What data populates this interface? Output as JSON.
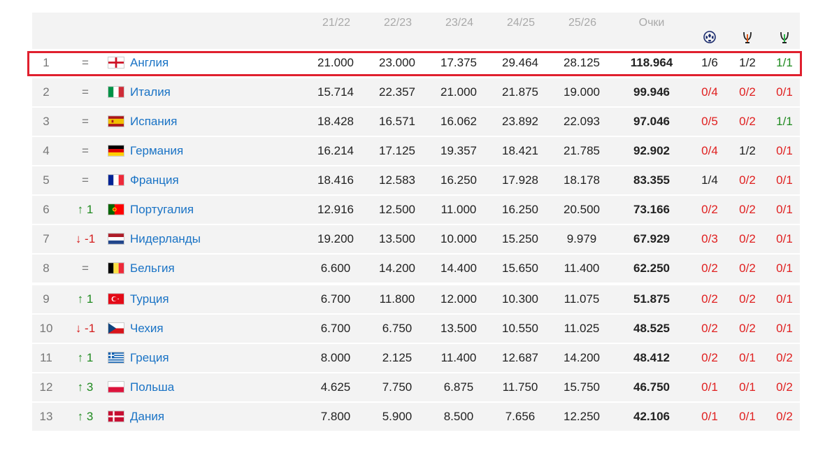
{
  "header": {
    "seasons": [
      "21/22",
      "22/23",
      "23/24",
      "24/25",
      "25/26"
    ],
    "points_label": "Очки",
    "competition_icons": [
      "champions-league-icon",
      "europa-league-icon",
      "conference-league-icon"
    ]
  },
  "colors": {
    "highlight_border": "#e0202e",
    "row_bg": "#f3f3f3",
    "country_link": "#1a73c5",
    "up": "#1f8a1f",
    "down": "#d41c1c",
    "eliminated": "#e02020"
  },
  "rows": [
    {
      "rank": "1",
      "move": "=",
      "move_dir": "same",
      "flag": "england",
      "country": "Англия",
      "scores": [
        "21.000",
        "23.000",
        "17.375",
        "29.464",
        "28.125"
      ],
      "total": "118.964",
      "ucl": "1/6",
      "ucl_c": "black",
      "uel": "1/2",
      "uel_c": "black",
      "uecl": "1/1",
      "uecl_c": "green"
    },
    {
      "rank": "2",
      "move": "=",
      "move_dir": "same",
      "flag": "italy",
      "country": "Италия",
      "scores": [
        "15.714",
        "22.357",
        "21.000",
        "21.875",
        "19.000"
      ],
      "total": "99.946",
      "ucl": "0/4",
      "ucl_c": "red",
      "uel": "0/2",
      "uel_c": "red",
      "uecl": "0/1",
      "uecl_c": "red"
    },
    {
      "rank": "3",
      "move": "=",
      "move_dir": "same",
      "flag": "spain",
      "country": "Испания",
      "scores": [
        "18.428",
        "16.571",
        "16.062",
        "23.892",
        "22.093"
      ],
      "total": "97.046",
      "ucl": "0/5",
      "ucl_c": "red",
      "uel": "0/2",
      "uel_c": "red",
      "uecl": "1/1",
      "uecl_c": "green"
    },
    {
      "rank": "4",
      "move": "=",
      "move_dir": "same",
      "flag": "germany",
      "country": "Германия",
      "scores": [
        "16.214",
        "17.125",
        "19.357",
        "18.421",
        "21.785"
      ],
      "total": "92.902",
      "ucl": "0/4",
      "ucl_c": "red",
      "uel": "1/2",
      "uel_c": "black",
      "uecl": "0/1",
      "uecl_c": "red"
    },
    {
      "rank": "5",
      "move": "=",
      "move_dir": "same",
      "flag": "france",
      "country": "Франция",
      "scores": [
        "18.416",
        "12.583",
        "16.250",
        "17.928",
        "18.178"
      ],
      "total": "83.355",
      "ucl": "1/4",
      "ucl_c": "black",
      "uel": "0/2",
      "uel_c": "red",
      "uecl": "0/1",
      "uecl_c": "red"
    },
    {
      "rank": "6",
      "move": "↑ 1",
      "move_dir": "up",
      "flag": "portugal",
      "country": "Португалия",
      "scores": [
        "12.916",
        "12.500",
        "11.000",
        "16.250",
        "20.500"
      ],
      "total": "73.166",
      "ucl": "0/2",
      "ucl_c": "red",
      "uel": "0/2",
      "uel_c": "red",
      "uecl": "0/1",
      "uecl_c": "red"
    },
    {
      "rank": "7",
      "move": "↓ -1",
      "move_dir": "down",
      "flag": "netherlands",
      "country": "Нидерланды",
      "scores": [
        "19.200",
        "13.500",
        "10.000",
        "15.250",
        "9.979"
      ],
      "total": "67.929",
      "ucl": "0/3",
      "ucl_c": "red",
      "uel": "0/2",
      "uel_c": "red",
      "uecl": "0/1",
      "uecl_c": "red"
    },
    {
      "rank": "8",
      "move": "=",
      "move_dir": "same",
      "flag": "belgium",
      "country": "Бельгия",
      "scores": [
        "6.600",
        "14.200",
        "14.400",
        "15.650",
        "11.400"
      ],
      "total": "62.250",
      "ucl": "0/2",
      "ucl_c": "red",
      "uel": "0/2",
      "uel_c": "red",
      "uecl": "0/1",
      "uecl_c": "red"
    },
    {
      "rank": "9",
      "move": "↑ 1",
      "move_dir": "up",
      "flag": "turkey",
      "country": "Турция",
      "scores": [
        "6.700",
        "11.800",
        "12.000",
        "10.300",
        "11.075"
      ],
      "total": "51.875",
      "ucl": "0/2",
      "ucl_c": "red",
      "uel": "0/2",
      "uel_c": "red",
      "uecl": "0/1",
      "uecl_c": "red"
    },
    {
      "rank": "10",
      "move": "↓ -1",
      "move_dir": "down",
      "flag": "czechia",
      "country": "Чехия",
      "scores": [
        "6.700",
        "6.750",
        "13.500",
        "10.550",
        "11.025"
      ],
      "total": "48.525",
      "ucl": "0/2",
      "ucl_c": "red",
      "uel": "0/2",
      "uel_c": "red",
      "uecl": "0/1",
      "uecl_c": "red"
    },
    {
      "rank": "11",
      "move": "↑ 1",
      "move_dir": "up",
      "flag": "greece",
      "country": "Греция",
      "scores": [
        "8.000",
        "2.125",
        "11.400",
        "12.687",
        "14.200"
      ],
      "total": "48.412",
      "ucl": "0/2",
      "ucl_c": "red",
      "uel": "0/1",
      "uel_c": "red",
      "uecl": "0/2",
      "uecl_c": "red"
    },
    {
      "rank": "12",
      "move": "↑ 3",
      "move_dir": "up",
      "flag": "poland",
      "country": "Польша",
      "scores": [
        "4.625",
        "7.750",
        "6.875",
        "11.750",
        "15.750"
      ],
      "total": "46.750",
      "ucl": "0/1",
      "ucl_c": "red",
      "uel": "0/1",
      "uel_c": "red",
      "uecl": "0/2",
      "uecl_c": "red"
    },
    {
      "rank": "13",
      "move": "↑ 3",
      "move_dir": "up",
      "flag": "denmark",
      "country": "Дания",
      "scores": [
        "7.800",
        "5.900",
        "8.500",
        "7.656",
        "12.250"
      ],
      "total": "42.106",
      "ucl": "0/1",
      "ucl_c": "red",
      "uel": "0/1",
      "uel_c": "red",
      "uecl": "0/2",
      "uecl_c": "red"
    }
  ]
}
